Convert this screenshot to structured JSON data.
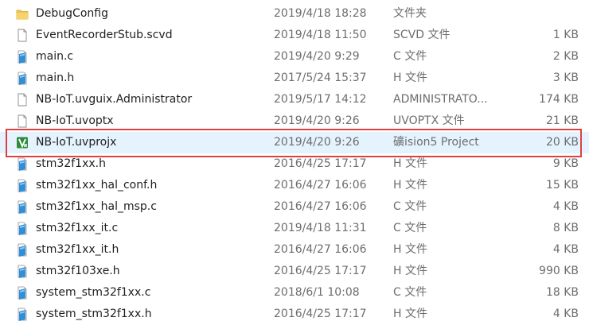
{
  "files": [
    {
      "name": "DebugConfig",
      "date": "2019/4/18 18:28",
      "type": "文件夹",
      "size": "",
      "icon": "folder-icon"
    },
    {
      "name": "EventRecorderStub.scvd",
      "date": "2019/4/18 11:50",
      "type": "SCVD 文件",
      "size": "1 KB",
      "icon": "blank-file-icon"
    },
    {
      "name": "main.c",
      "date": "2019/4/20 9:29",
      "type": "C 文件",
      "size": "2 KB",
      "icon": "source-file-icon"
    },
    {
      "name": "main.h",
      "date": "2017/5/24 15:37",
      "type": "H 文件",
      "size": "3 KB",
      "icon": "source-file-icon"
    },
    {
      "name": "NB-IoT.uvguix.Administrator",
      "date": "2019/5/17 14:12",
      "type": "ADMINISTRATO...",
      "size": "174 KB",
      "icon": "blank-file-icon"
    },
    {
      "name": "NB-IoT.uvoptx",
      "date": "2019/4/20 9:26",
      "type": "UVOPTX 文件",
      "size": "21 KB",
      "icon": "blank-file-icon"
    },
    {
      "name": "NB-IoT.uvprojx",
      "date": "2019/4/20 9:26",
      "type": "礦ision5 Project",
      "size": "20 KB",
      "icon": "keil-project-icon"
    },
    {
      "name": "stm32f1xx.h",
      "date": "2016/4/25 17:17",
      "type": "H 文件",
      "size": "9 KB",
      "icon": "source-file-icon"
    },
    {
      "name": "stm32f1xx_hal_conf.h",
      "date": "2016/4/27 16:06",
      "type": "H 文件",
      "size": "15 KB",
      "icon": "source-file-icon"
    },
    {
      "name": "stm32f1xx_hal_msp.c",
      "date": "2016/4/27 16:06",
      "type": "C 文件",
      "size": "4 KB",
      "icon": "source-file-icon"
    },
    {
      "name": "stm32f1xx_it.c",
      "date": "2019/4/18 11:31",
      "type": "C 文件",
      "size": "8 KB",
      "icon": "source-file-icon"
    },
    {
      "name": "stm32f1xx_it.h",
      "date": "2016/4/27 16:06",
      "type": "H 文件",
      "size": "4 KB",
      "icon": "source-file-icon"
    },
    {
      "name": "stm32f103xe.h",
      "date": "2016/4/25 17:17",
      "type": "H 文件",
      "size": "990 KB",
      "icon": "source-file-icon"
    },
    {
      "name": "system_stm32f1xx.c",
      "date": "2018/6/1 10:08",
      "type": "C 文件",
      "size": "18 KB",
      "icon": "source-file-icon"
    },
    {
      "name": "system_stm32f1xx.h",
      "date": "2016/4/25 17:17",
      "type": "H 文件",
      "size": "4 KB",
      "icon": "source-file-icon"
    }
  ],
  "selected_index": 6,
  "colors": {
    "selection_background": "#e5f3ff",
    "highlight_border": "#e0403f",
    "folder": "#f0c24a",
    "source_icon": "#2f8fd8",
    "keil_icon": "#2e8b3a"
  }
}
